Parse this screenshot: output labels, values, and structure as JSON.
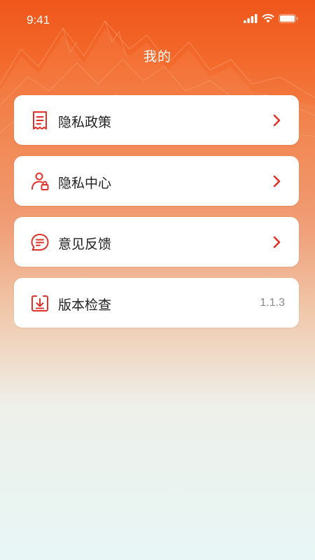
{
  "status_bar": {
    "time": "9:41"
  },
  "header": {
    "title": "我的"
  },
  "menu": {
    "items": [
      {
        "label": "隐私政策",
        "icon": "document-icon"
      },
      {
        "label": "隐私中心",
        "icon": "user-lock-icon"
      },
      {
        "label": "意见反馈",
        "icon": "chat-icon"
      },
      {
        "label": "版本检查",
        "icon": "download-box-icon",
        "value": "1.1.3"
      }
    ]
  },
  "colors": {
    "accent": "#e0322a",
    "header_top": "#f0561a",
    "background_bottom": "#e8f6f5"
  }
}
